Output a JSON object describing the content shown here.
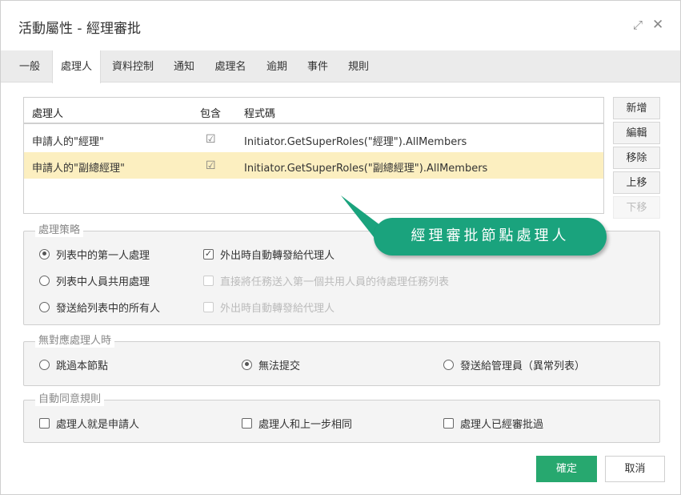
{
  "dialog": {
    "title": "活動屬性 - 經理審批"
  },
  "tabs": [
    {
      "label": "一般"
    },
    {
      "label": "處理人"
    },
    {
      "label": "資料控制"
    },
    {
      "label": "通知"
    },
    {
      "label": "處理名"
    },
    {
      "label": "逾期"
    },
    {
      "label": "事件"
    },
    {
      "label": "規則"
    }
  ],
  "active_tab": "處理人",
  "grid": {
    "headers": {
      "handler": "處理人",
      "include": "包含",
      "code": "程式碼"
    },
    "rows": [
      {
        "handler": "申請人的\"經理\"",
        "include": true,
        "code": "Initiator.GetSuperRoles(\"經理\").AllMembers"
      },
      {
        "handler": "申請人的\"副總經理\"",
        "include": true,
        "code": "Initiator.GetSuperRoles(\"副總經理\").AllMembers",
        "selected": true
      }
    ]
  },
  "side_buttons": {
    "add": "新增",
    "edit": "編輯",
    "remove": "移除",
    "up": "上移",
    "down": "下移"
  },
  "callout": "經理審批節點處理人",
  "strategy": {
    "legend": "處理策略",
    "options": [
      "列表中的第一人處理",
      "列表中人員共用處理",
      "發送給列表中的所有人"
    ],
    "selected_index": 0,
    "checks": [
      {
        "label": "外出時自動轉發給代理人",
        "checked": true,
        "enabled": true
      },
      {
        "label": "直接將任務送入第一個共用人員的待處理任務列表",
        "checked": false,
        "enabled": false
      },
      {
        "label": "外出時自動轉發給代理人",
        "checked": false,
        "enabled": false
      }
    ]
  },
  "no_handler": {
    "legend": "無對應處理人時",
    "options": [
      "跳過本節點",
      "無法提交",
      "發送給管理員（異常列表）"
    ],
    "selected_index": 1
  },
  "auto_agree": {
    "legend": "自動同意規則",
    "options": [
      "處理人就是申請人",
      "處理人和上一步相同",
      "處理人已經審批過"
    ]
  },
  "footer": {
    "ok": "確定",
    "cancel": "取消"
  },
  "colors": {
    "ok_green": "#27a86f",
    "callout_green": "#1aa37d",
    "selected_row": "#fcefc0"
  }
}
